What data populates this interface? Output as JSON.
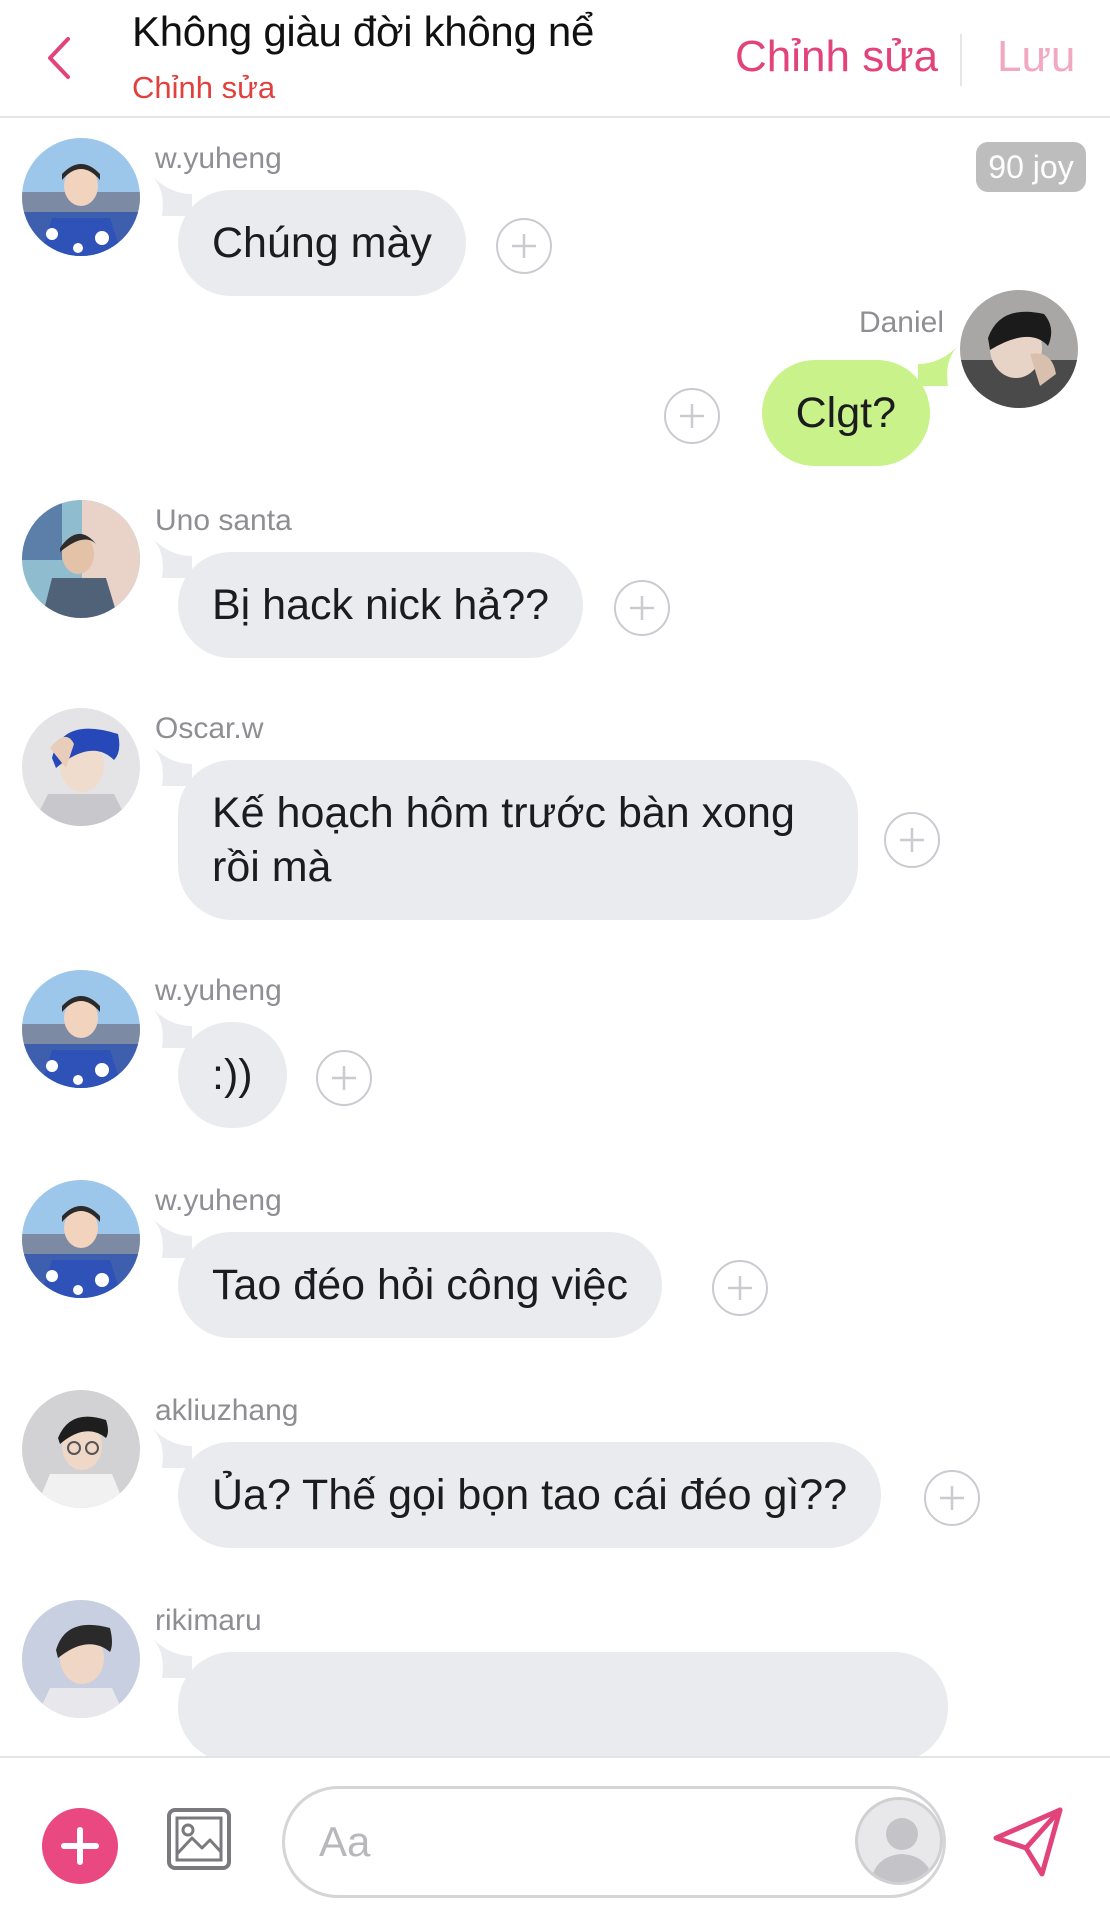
{
  "header": {
    "title": "Không giàu đời không nể",
    "subtitle": "Chỉnh sửa",
    "edit_label": "Chỉnh sửa",
    "save_label": "Lưu",
    "back_icon": "chevron-left-icon"
  },
  "badge": {
    "label": "90 joy"
  },
  "messages": [
    {
      "sender": "w.yuheng",
      "text": "Chúng mày",
      "side": "left"
    },
    {
      "sender": "Daniel",
      "text": "Clgt?",
      "side": "right"
    },
    {
      "sender": "Uno santa",
      "text": "Bị hack nick hả??",
      "side": "left"
    },
    {
      "sender": "Oscar.w",
      "text": "Kế hoạch hôm trước bàn xong rồi mà",
      "side": "left"
    },
    {
      "sender": "w.yuheng",
      "text": ":))",
      "side": "left"
    },
    {
      "sender": "w.yuheng",
      "text": "Tao đéo hỏi công việc",
      "side": "left"
    },
    {
      "sender": "akliuzhang",
      "text": "Ủa? Thế gọi bọn tao cái đéo gì??",
      "side": "left"
    },
    {
      "sender": "rikimaru",
      "text": "",
      "side": "left"
    }
  ],
  "composer": {
    "placeholder": "Aa",
    "add_icon": "plus-icon",
    "image_icon": "image-icon",
    "send_icon": "send-icon"
  },
  "colors": {
    "accent": "#e2437a",
    "subtitle": "#e0413f",
    "my_bubble": "#c9f28b",
    "other_bubble": "#e9ebee"
  }
}
